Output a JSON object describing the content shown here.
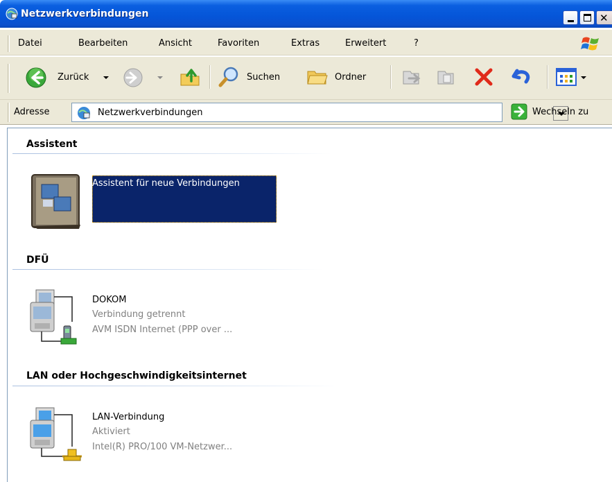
{
  "window": {
    "title": "Netzwerkverbindungen",
    "icons": {
      "app": "network-connections-icon",
      "minimize": "minimize-icon",
      "maximize": "maximize-icon",
      "close": "close-icon"
    }
  },
  "menu": {
    "items": [
      "Datei",
      "Bearbeiten",
      "Ansicht",
      "Favoriten",
      "Extras",
      "Erweitert",
      "?"
    ],
    "logo": "windows-logo-icon"
  },
  "toolbar": {
    "back_label": "Zurück",
    "search_label": "Suchen",
    "folders_label": "Ordner",
    "icons": [
      "back-arrow-icon",
      "forward-arrow-icon",
      "up-folder-icon",
      "search-icon",
      "folder-icon",
      "move-to-icon",
      "copy-to-icon",
      "delete-icon",
      "undo-icon",
      "views-icon"
    ]
  },
  "address": {
    "label": "Adresse",
    "value": "Netzwerkverbindungen",
    "go_label": "Wechseln zu"
  },
  "groups": [
    {
      "header": "Assistent",
      "items": [
        {
          "name": "Assistent für neue Verbindungen",
          "icon": "wizard-icon",
          "selected": true
        }
      ]
    },
    {
      "header": "DFÜ",
      "items": [
        {
          "name": "DOKOM",
          "status": "Verbindung getrennt",
          "device": "AVM ISDN Internet (PPP over ...",
          "icon": "dialup-connection-icon"
        }
      ]
    },
    {
      "header": "LAN oder Hochgeschwindigkeitsinternet",
      "items": [
        {
          "name": "LAN-Verbindung",
          "status": "Aktiviert",
          "device": "Intel(R) PRO/100 VM-Netzwer...",
          "icon": "lan-connection-icon"
        }
      ]
    }
  ],
  "colors": {
    "titlebar": "#0555d8",
    "toolbar_bg": "#ece9d8",
    "selection": "#0a246a",
    "secondary_text": "#808080"
  }
}
